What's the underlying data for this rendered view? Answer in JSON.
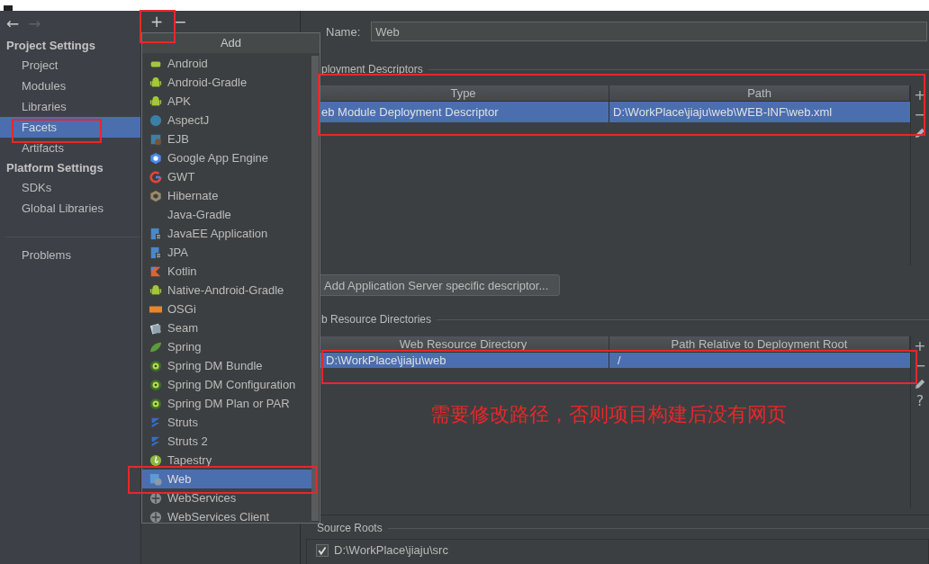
{
  "nav": {
    "back": {
      "label": "←",
      "disabled": false
    },
    "forward": {
      "label": "→",
      "disabled": true
    }
  },
  "sidebar": {
    "sections": [
      {
        "title": "Project Settings",
        "items": [
          {
            "label": "Project",
            "selected": false
          },
          {
            "label": "Modules",
            "selected": false
          },
          {
            "label": "Libraries",
            "selected": false
          },
          {
            "label": "Facets",
            "selected": true
          },
          {
            "label": "Artifacts",
            "selected": false
          }
        ]
      },
      {
        "title": "Platform Settings",
        "items": [
          {
            "label": "SDKs",
            "selected": false
          },
          {
            "label": "Global Libraries",
            "selected": false
          }
        ]
      }
    ],
    "footer_items": [
      {
        "label": "Problems",
        "selected": false
      }
    ]
  },
  "toolbar": {
    "buttons": [
      "+",
      "−"
    ]
  },
  "add_menu": {
    "title": "Add",
    "items": [
      {
        "label": "Android",
        "selected": false
      },
      {
        "label": "Android-Gradle",
        "selected": false
      },
      {
        "label": "APK",
        "selected": false
      },
      {
        "label": "AspectJ",
        "selected": false
      },
      {
        "label": "EJB",
        "selected": false
      },
      {
        "label": "Google App Engine",
        "selected": false
      },
      {
        "label": "GWT",
        "selected": false
      },
      {
        "label": "Hibernate",
        "selected": false
      },
      {
        "label": "Java-Gradle",
        "selected": false
      },
      {
        "label": "JavaEE Application",
        "selected": false
      },
      {
        "label": "JPA",
        "selected": false
      },
      {
        "label": "Kotlin",
        "selected": false
      },
      {
        "label": "Native-Android-Gradle",
        "selected": false
      },
      {
        "label": "OSGi",
        "selected": false
      },
      {
        "label": "Seam",
        "selected": false
      },
      {
        "label": "Spring",
        "selected": false
      },
      {
        "label": "Spring DM Bundle",
        "selected": false
      },
      {
        "label": "Spring DM Configuration",
        "selected": false
      },
      {
        "label": "Spring DM Plan or PAR",
        "selected": false
      },
      {
        "label": "Struts",
        "selected": false
      },
      {
        "label": "Struts 2",
        "selected": false
      },
      {
        "label": "Tapestry",
        "selected": false
      },
      {
        "label": "Web",
        "selected": true
      },
      {
        "label": "WebServices",
        "selected": false
      },
      {
        "label": "WebServices Client",
        "selected": false
      }
    ]
  },
  "facet": {
    "name_label": "Name:",
    "name": "Web",
    "deployment_descriptors": {
      "title": "ployment Descriptors",
      "columns": [
        "Type",
        "Path"
      ],
      "rows": [
        {
          "cells": [
            "eb Module Deployment Descriptor",
            "D:\\WorkPlace\\jiaju\\web\\WEB-INF\\web.xml"
          ],
          "selected": true
        }
      ],
      "tools": [
        "+",
        "−"
      ]
    },
    "server_descriptor_button": "Add Application Server specific descriptor...",
    "web_resource_directories": {
      "title": "b Resource Directories",
      "columns": [
        "Web Resource Directory",
        "Path Relative to Deployment Root"
      ],
      "rows": [
        {
          "cells": [
            "D:\\WorkPlace\\jiaju\\web",
            "/"
          ],
          "selected": true
        }
      ],
      "tools": [
        "+",
        "−"
      ],
      "help": "?"
    },
    "source_roots": {
      "title": "Source Roots",
      "items": [
        {
          "label": "D:\\WorkPlace\\jiaju\\src",
          "checked": true
        }
      ]
    }
  },
  "annotation": {
    "note": "需要修改路径，否则项目构建后没有网页"
  }
}
